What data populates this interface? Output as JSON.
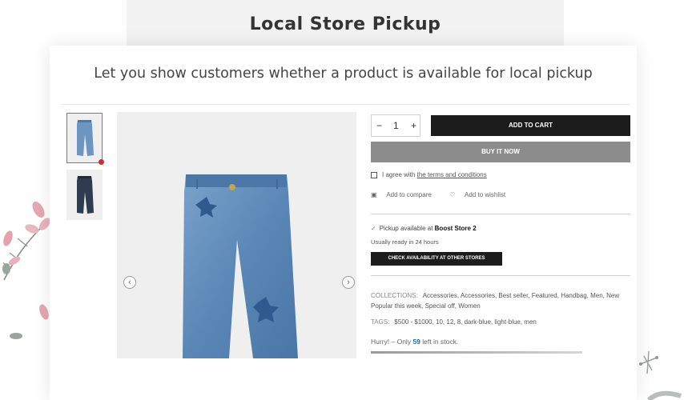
{
  "page": {
    "title": "Local Store Pickup",
    "subtitle": "Let you show customers whether a product is available for local pickup"
  },
  "product": {
    "quantity": "1",
    "qty_minus": "−",
    "qty_plus": "+",
    "add_to_cart": "ADD TO CART",
    "buy_it_now": "BUY IT NOW",
    "agree_text": "I agree with",
    "terms_link": "the terms and conditions",
    "add_to_compare": "Add to compare",
    "add_to_wishlist": "Add to wishlist",
    "pickup_prefix": "Pickup available at",
    "pickup_store": "Boost Store 2",
    "ready_text": "Usually ready in 24 hours",
    "check_availability": "CHECK AVAILABILITY AT OTHER STORES",
    "collections_label": "COLLECTIONS:",
    "collections_line1": "Accessories,  Accessories,  Best seller,  Featured,  Handbag,  Men,  New",
    "collections_line2": "Popular this week,  Special off,  Women",
    "tags_label": "TAGS:",
    "tags": "$500 - $1000,  10,  12,  8,  dark-blue,  light-blue,  men",
    "stock_prefix": "Hurry! – Only",
    "stock_count": "59",
    "stock_suffix": "left in stock."
  },
  "colors": {
    "cart_button": "#1c1c1c",
    "buy_button": "#8c8c8c",
    "stock_highlight": "#1f6fb6",
    "thumb_active_border": "#d9534f"
  },
  "icons": {
    "prev": "chevron-left-icon",
    "next": "chevron-right-icon",
    "compare": "compare-icon",
    "wishlist": "heart-icon",
    "pickup": "check-icon"
  }
}
